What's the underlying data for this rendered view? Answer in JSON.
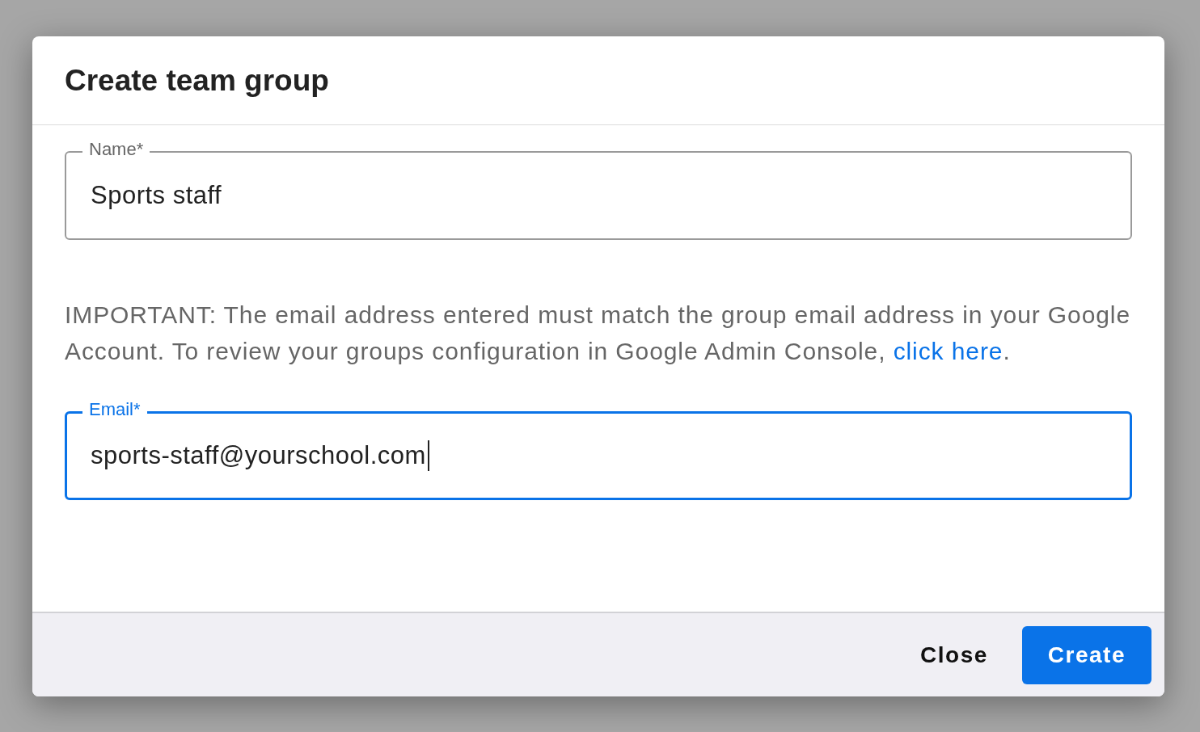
{
  "dialog": {
    "title": "Create team group",
    "fields": [
      {
        "label": "Name*",
        "value": "Sports staff",
        "focused": false
      },
      {
        "label": "Email*",
        "value": "sports-staff@yourschool.com",
        "focused": true
      }
    ],
    "notice": {
      "text": "IMPORTANT: The email address entered must match the group email address in your Google Account. To review your groups configuration in Google Admin Console, ",
      "link": "click here",
      "trailing": "."
    },
    "buttons": [
      {
        "label": "Close",
        "kind": "text"
      },
      {
        "label": "Create",
        "kind": "primary"
      }
    ]
  }
}
